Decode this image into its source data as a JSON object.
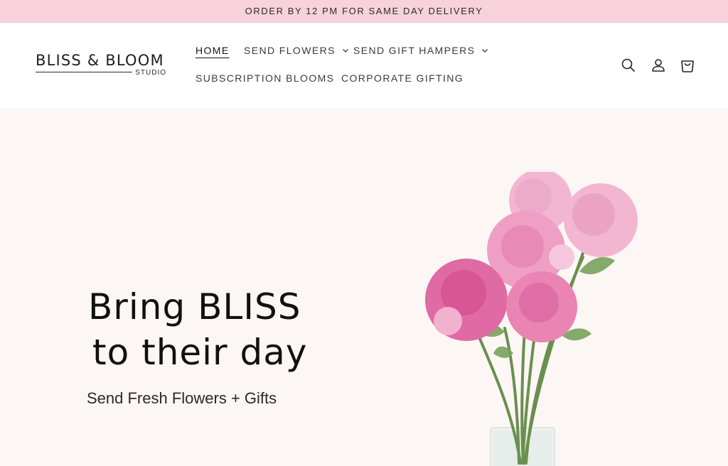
{
  "announcement": {
    "text": "ORDER BY 12 PM FOR SAME DAY DELIVERY"
  },
  "logo": {
    "main": "BLISS & BLOOM",
    "sub": "STUDIO"
  },
  "nav": {
    "home": "HOME",
    "send_flowers": "SEND FLOWERS",
    "send_gift_hampers": "SEND GIFT HAMPERS",
    "subscription_blooms": "SUBSCRIPTION BLOOMS",
    "corporate_gifting": "CORPORATE GIFTING"
  },
  "header_icons": [
    "search-icon",
    "account-icon",
    "cart-icon"
  ],
  "hero": {
    "title_line1": "Bring BLISS",
    "title_line2": "to their day",
    "subtitle": "Send Fresh Flowers + Gifts"
  },
  "colors": {
    "announcement_bg": "#f7d2dc",
    "hero_bg": "#fcf6f5",
    "peony_pink": "#e98ab6",
    "peony_light": "#f2b6d1"
  }
}
